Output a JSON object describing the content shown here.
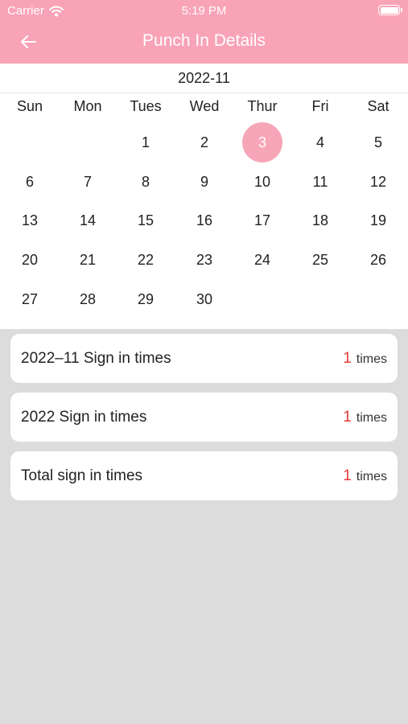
{
  "status_bar": {
    "carrier": "Carrier",
    "time": "5:19 PM"
  },
  "nav": {
    "title": "Punch In Details",
    "back_icon": "arrow-left-icon"
  },
  "calendar": {
    "month": "2022-11",
    "weekdays": [
      "Sun",
      "Mon",
      "Tues",
      "Wed",
      "Thur",
      "Fri",
      "Sat"
    ],
    "days": [
      "1",
      "2",
      "3",
      "4",
      "5",
      "6",
      "7",
      "8",
      "9",
      "10",
      "11",
      "12",
      "13",
      "14",
      "15",
      "16",
      "17",
      "18",
      "19",
      "20",
      "21",
      "22",
      "23",
      "24",
      "25",
      "26",
      "27",
      "28",
      "29",
      "30"
    ],
    "selected_day": "3",
    "selected_color": "#f7a6b8"
  },
  "stats": [
    {
      "label": "2022–11 Sign in times",
      "count": "1",
      "unit": "times"
    },
    {
      "label": "2022 Sign in times",
      "count": "1",
      "unit": "times"
    },
    {
      "label": "Total sign in times",
      "count": "1",
      "unit": "times"
    }
  ],
  "colors": {
    "header": "#f9a3b6",
    "count": "#e63b3b",
    "background": "#dcdcdc"
  }
}
